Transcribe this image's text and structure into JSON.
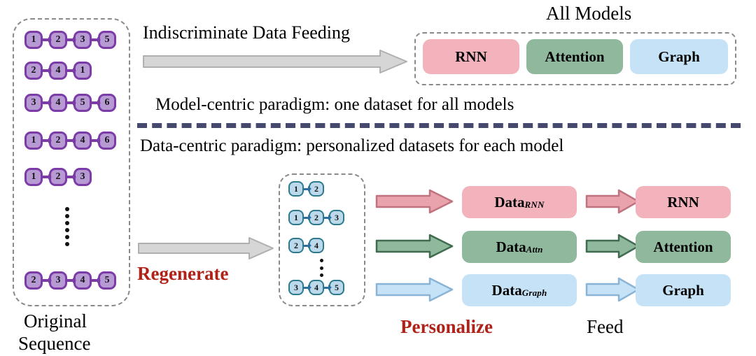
{
  "figure": {
    "title_all_models": "All Models",
    "divider_present": true
  },
  "left_panel": {
    "caption_line1": "Original",
    "caption_line2": "Sequence",
    "ellipsis": "vertical-dots",
    "sequences": [
      [
        1,
        2,
        3,
        5
      ],
      [
        2,
        4,
        1
      ],
      [
        3,
        4,
        5,
        6
      ],
      [
        1,
        2,
        4,
        6
      ],
      [
        1,
        2,
        3
      ],
      [
        2,
        3,
        4,
        5
      ]
    ]
  },
  "top_flow": {
    "arrow_label": "Indiscriminate Data Feeding",
    "paradigm": "Model-centric paradigm: one dataset for all models",
    "models": [
      {
        "label": "RNN",
        "color": "#f2b3bc"
      },
      {
        "label": "Attention",
        "color": "#8fb89d"
      },
      {
        "label": "Graph",
        "color": "#c6e2f7"
      }
    ]
  },
  "bottom_flow": {
    "paradigm": "Data-centric paradigm: personalized datasets for each model",
    "step_regenerate": "Regenerate",
    "step_personalize": "Personalize",
    "step_feed": "Feed",
    "regenerated_sequences": [
      [
        1,
        2
      ],
      [
        1,
        2,
        3
      ],
      [
        2,
        4
      ],
      [
        3,
        4,
        5
      ]
    ],
    "ellipsis": "vertical-dots",
    "rows": [
      {
        "data_base": "Data",
        "data_sub": "RNN",
        "model": "RNN",
        "color": "#f2b3bc",
        "arrow_color": "#e8a3ad",
        "arrow_stroke": "#c0737f"
      },
      {
        "data_base": "Data",
        "data_sub": "Attn",
        "model": "Attention",
        "color": "#8fb89d",
        "arrow_color": "#8fb89d",
        "arrow_stroke": "#3f6b4e"
      },
      {
        "data_base": "Data",
        "data_sub": "Graph",
        "model": "Graph",
        "color": "#c6e2f7",
        "arrow_color": "#c6e2f7",
        "arrow_stroke": "#8ab4d6"
      }
    ]
  },
  "colors": {
    "node_purple_fill": "#b79ad3",
    "node_purple_border": "#7b3ca8",
    "node_blue_fill": "#bcd9ec",
    "node_blue_border": "#2d7a8d",
    "accent_red": "#b02118",
    "divider": "#46496e",
    "dash_border": "#8a8a8a",
    "gray_arrow": "#d4d4d4"
  }
}
